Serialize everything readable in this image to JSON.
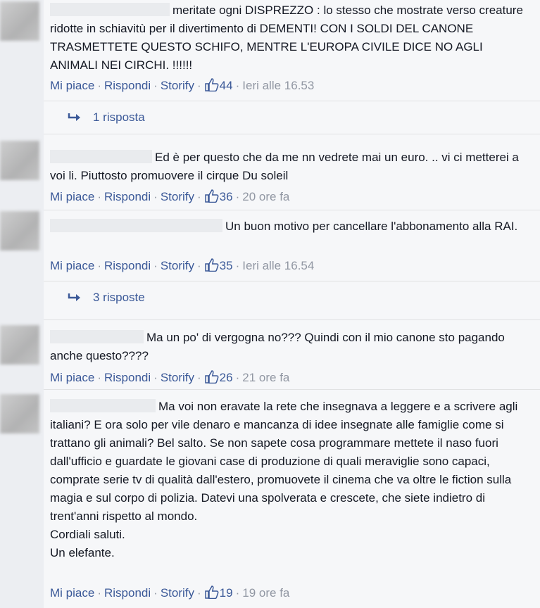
{
  "actions": {
    "like": "Mi piace",
    "reply": "Rispondi",
    "storify": "Storify",
    "sep": "·"
  },
  "comments": [
    {
      "text": "meritate ogni DISPREZZO : lo stesso che mostrate verso creature ridotte in schiavitù per il divertimento di DEMENTI! CON I SOLDI DEL CANONE TRASMETTETE QUESTO SCHIFO, MENTRE L'EUROPA CIVILE DICE NO AGLI ANIMALI NEI CIRCHI. !!!!!!",
      "likes": "44",
      "time": "Ieri alle 16.53",
      "replies": "1 risposta"
    },
    {
      "text": "Ed è per questo che da me nn vedrete mai un euro. .. vi ci metterei a voi li. Piuttosto promuovere il cirque Du soleil",
      "likes": "36",
      "time": "20 ore fa"
    },
    {
      "text": "Un buon motivo per cancellare l'abbonamento alla RAI.",
      "likes": "35",
      "time": "Ieri alle 16.54",
      "replies": "3 risposte"
    },
    {
      "text": "Ma un po' di vergogna no??? Quindi con il mio canone sto pagando anche questo????",
      "likes": "26",
      "time": "21 ore fa"
    },
    {
      "text": "Ma voi non eravate la rete che insegnava a leggere e a scrivere agli italiani? E ora solo per vile denaro e mancanza di idee insegnate alle famiglie come si trattano gli animali? Bel salto. Se non sapete cosa programmare mettete il naso fuori dall'ufficio e guardate le giovani case di produzione di quali meraviglie sono capaci, comprate serie tv di qualità dall'estero, promuovete il cinema che va oltre le fiction sulla magia e sul corpo di polizia. Datevi una spolverata e crescete, che siete indietro di trent'anni rispetto al mondo.",
      "closing1": "Cordiali saluti.",
      "closing2": "Un elefante.",
      "likes": "19",
      "time": "19 ore fa"
    }
  ],
  "colors": {
    "link": "#3b5998",
    "meta": "#9197a3",
    "text": "#141823"
  }
}
